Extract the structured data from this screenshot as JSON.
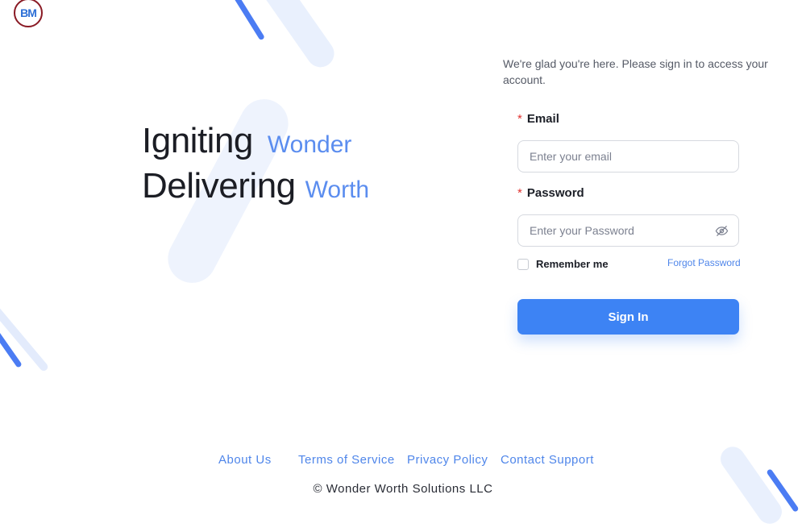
{
  "brand": {
    "logo_text": "BM"
  },
  "hero": {
    "line1_strong": "Igniting",
    "line1_accent": "Wonder",
    "line2_strong": "Delivering",
    "line2_accent": "Worth"
  },
  "login": {
    "intro": "We're glad you're here. Please sign in to access your account.",
    "required_mark": "*",
    "email_label": "Email",
    "email_placeholder": "Enter your email",
    "email_value": "",
    "password_label": "Password",
    "password_placeholder": "Enter your Password",
    "password_value": "",
    "password_toggle_icon": "eye-slash-icon",
    "remember_label": "Remember me",
    "remember_checked": false,
    "forgot_label": "Forgot Password",
    "signin_label": "Sign In"
  },
  "footer": {
    "links": [
      "About Us",
      "Terms of Service",
      "Privacy Policy",
      "Contact Support"
    ],
    "copyright": "© Wonder Worth Solutions LLC"
  },
  "colors": {
    "accent": "#3d83f4",
    "accent_text": "#5b8def",
    "required": "#e0322f",
    "logo_ring": "#8a1a24",
    "deco_light": "#e9f0fd",
    "deco_strong": "#4b7cf3"
  }
}
